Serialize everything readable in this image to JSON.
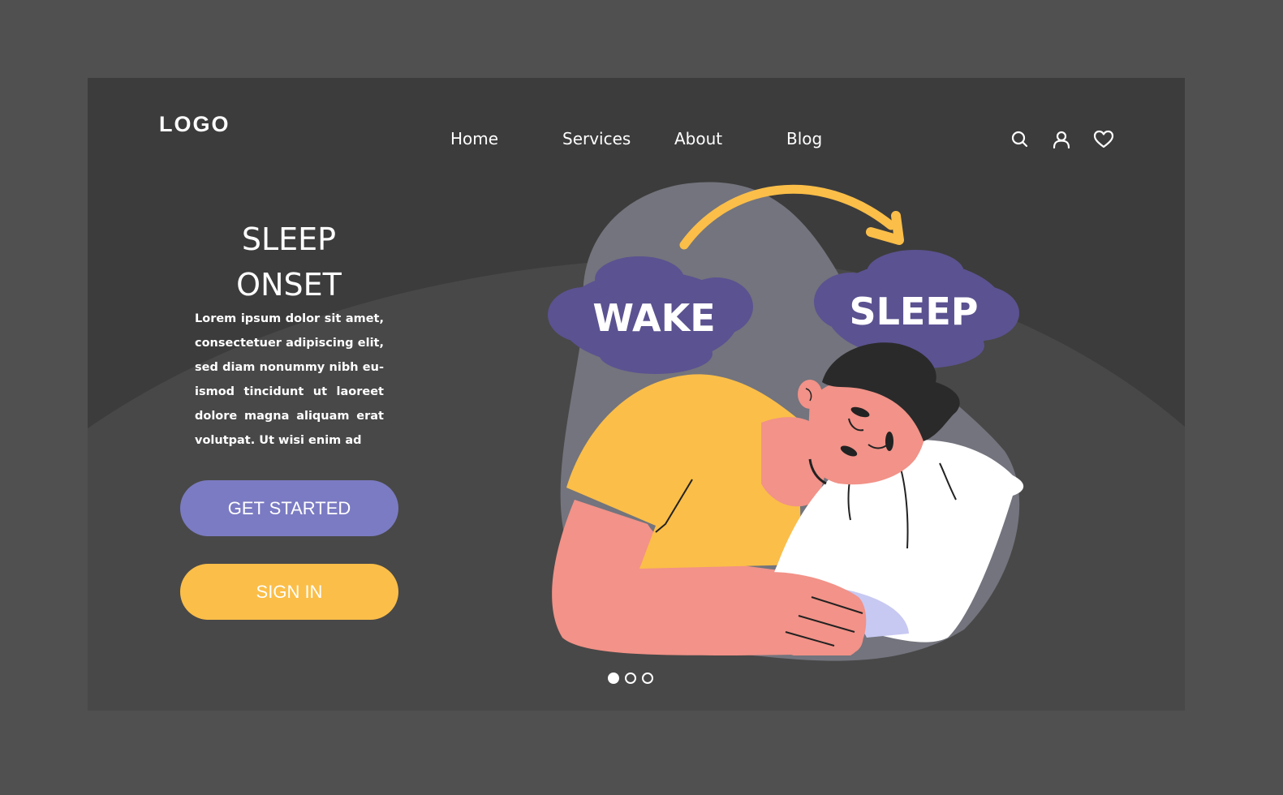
{
  "header": {
    "logo": "LOGO",
    "nav": [
      {
        "label": "Home"
      },
      {
        "label": "Services"
      },
      {
        "label": "About"
      },
      {
        "label": "Blog"
      }
    ],
    "icons": [
      "search-icon",
      "user-icon",
      "heart-icon"
    ]
  },
  "hero": {
    "title_line1": "SLEEP",
    "title_line2": "ONSET",
    "body": "Lorem ipsum dolor sit amet, consectetuer adipiscing elit, sed diam nonummy nibh eu-ismod tincidunt ut laoreet dolore magna aliquam erat volutpat. Ut wisi enim ad",
    "primary_button": "GET STARTED",
    "secondary_button": "SIGN IN"
  },
  "illustration": {
    "cloud_left": "WAKE",
    "cloud_right": "SLEEP"
  },
  "carousel": {
    "total": 3,
    "active_index": 0
  },
  "colors": {
    "page_bg": "#505050",
    "frame_bg": "#3c3c3c",
    "primary": "#7b7bc3",
    "secondary": "#fbbe48",
    "cloud": "#5b5291",
    "skin": "#f29288",
    "shirt": "#fbbe48"
  }
}
